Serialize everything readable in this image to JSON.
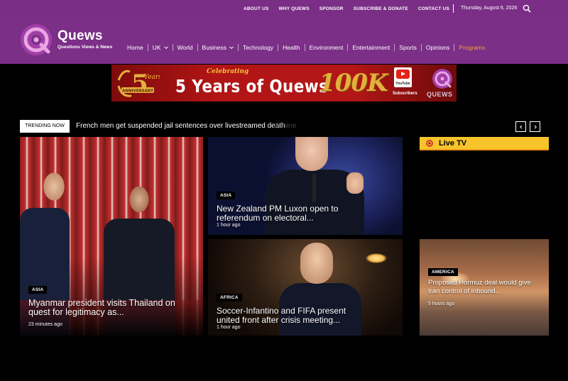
{
  "topbar": {
    "links": [
      "ABOUT US",
      "WHY QUEWS",
      "SPONSOR",
      "SUBSCRIBE & DONATE",
      "CONTACT US"
    ],
    "date": "Thursday, August 6, 2026",
    "search_icon": "search-icon"
  },
  "header": {
    "brand": "Quews",
    "tagline": "Questions Views & News",
    "nav": [
      {
        "label": "Home",
        "dropdown": false
      },
      {
        "label": "UK",
        "dropdown": true
      },
      {
        "label": "World",
        "dropdown": false
      },
      {
        "label": "Business",
        "dropdown": true
      },
      {
        "label": "Technology",
        "dropdown": false
      },
      {
        "label": "Health",
        "dropdown": false
      },
      {
        "label": "Environment",
        "dropdown": false
      },
      {
        "label": "Entertainment",
        "dropdown": false
      },
      {
        "label": "Sports",
        "dropdown": false
      },
      {
        "label": "Opinions",
        "dropdown": false
      },
      {
        "label": "Programs",
        "dropdown": false,
        "active": true
      }
    ],
    "colors": {
      "purple": "#7b2f87",
      "active_nav": "#f3a431"
    }
  },
  "banner": {
    "anniv_number": "5",
    "anniv_years": "Years",
    "anniv_label": "ANNIVERSARY",
    "celebrating": "Celebrating",
    "headline": "5 Years of Quews",
    "milestone": "100K",
    "youtube": "YouTube",
    "subscribers": "Subscribers",
    "brand": "QUEWS"
  },
  "trending": {
    "label": "TRENDING NOW",
    "headline": "French men get suspended jail sentences over livestreamed death",
    "next_fragment": "Ukraine"
  },
  "live_tv": {
    "label": "Live TV",
    "accent": "#f7c42b"
  },
  "articles": [
    {
      "tag": "ASIA",
      "title": "Myanmar president visits Thailand on quest for legitimacy as...",
      "time": "23 minutes ago"
    },
    {
      "tag": "ASIA",
      "title": "New Zealand PM Luxon open to referendum on electoral...",
      "time": "1 hour ago"
    },
    {
      "tag": "AFRICA",
      "title": "Soccer-Infantino and FIFA present united front after crisis meeting...",
      "time": "1 hour ago"
    },
    {
      "tag": "AMERICA",
      "title": "Proposed Hormuz deal would give Iran control of inbound...",
      "time": "5 hours ago"
    }
  ]
}
